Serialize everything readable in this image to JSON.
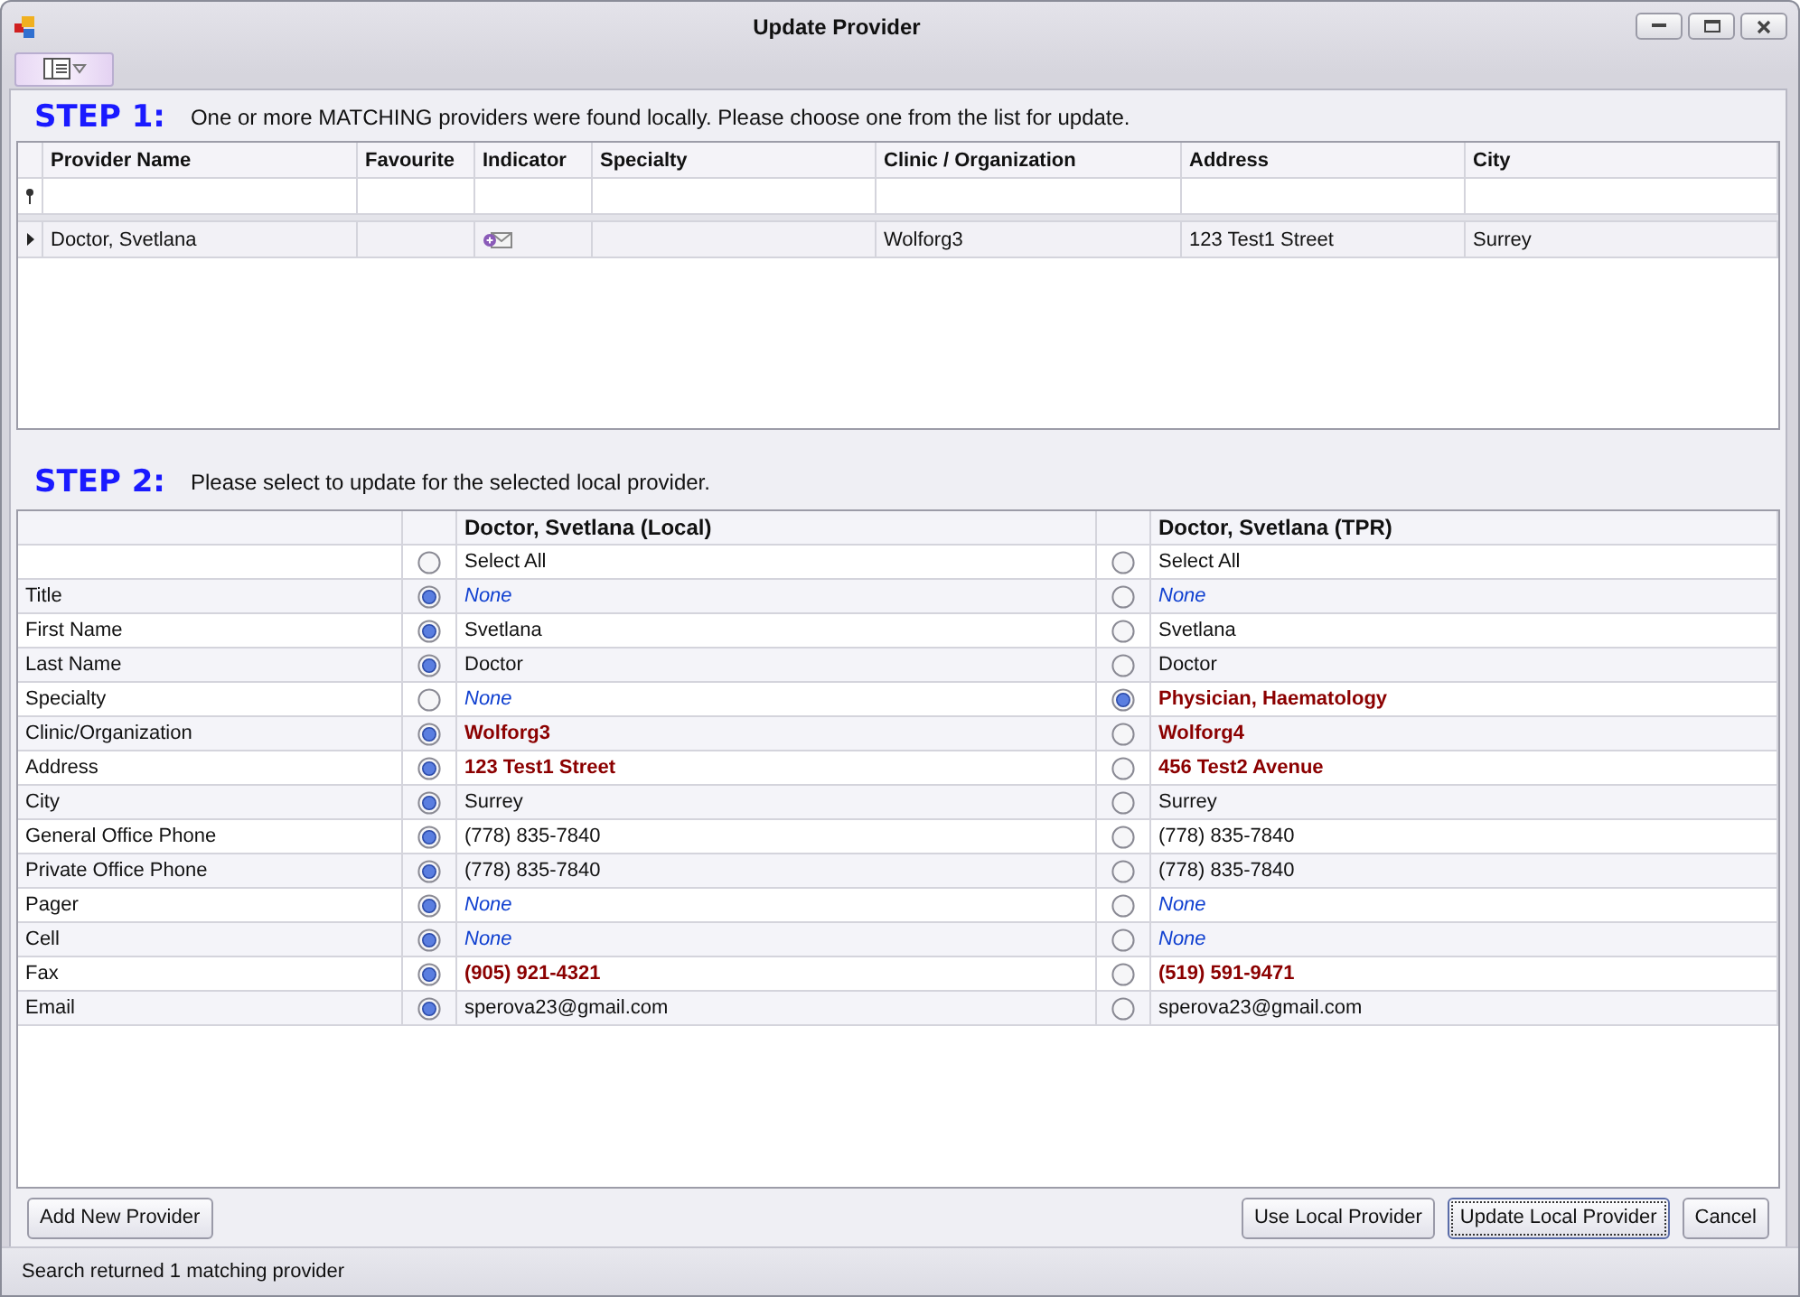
{
  "window": {
    "title": "Update Provider"
  },
  "step1": {
    "label": "STEP 1:",
    "instruction": "One or more MATCHING providers were found locally.  Please choose one from the list for update."
  },
  "providers_table": {
    "columns": [
      "Provider Name",
      "Favourite",
      "Indicator",
      "Specialty",
      "Clinic / Organization",
      "Address",
      "City"
    ],
    "rows": [
      {
        "selected": true,
        "provider_name": "Doctor, Svetlana",
        "indicator_shown": true,
        "clinic_organization": "Wolforg3",
        "address": "123  Test1 Street",
        "city": "Surrey"
      }
    ]
  },
  "step2": {
    "label": "STEP 2:",
    "instruction": "Please select to update for the selected local provider."
  },
  "compare": {
    "sources": [
      {
        "name": "Doctor, Svetlana (Local)",
        "select_all": "Select All",
        "select_all_selected": false
      },
      {
        "name": "Doctor, Svetlana (TPR)",
        "select_all": "Select All",
        "select_all_selected": false
      }
    ],
    "fields": [
      {
        "label": "Title",
        "values": [
          {
            "text": "None",
            "kind": "none",
            "selected": true
          },
          {
            "text": "None",
            "kind": "none",
            "selected": false
          }
        ]
      },
      {
        "label": "First Name",
        "values": [
          {
            "text": "Svetlana",
            "kind": "plain",
            "selected": true
          },
          {
            "text": "Svetlana",
            "kind": "plain",
            "selected": false
          }
        ]
      },
      {
        "label": "Last Name",
        "values": [
          {
            "text": "Doctor",
            "kind": "plain",
            "selected": true
          },
          {
            "text": "Doctor",
            "kind": "plain",
            "selected": false
          }
        ]
      },
      {
        "label": "Specialty",
        "values": [
          {
            "text": "None",
            "kind": "none",
            "selected": false
          },
          {
            "text": "Physician, Haematology",
            "kind": "diff",
            "selected": true
          }
        ]
      },
      {
        "label": "Clinic/Organization",
        "values": [
          {
            "text": "Wolforg3",
            "kind": "diff",
            "selected": true
          },
          {
            "text": "Wolforg4",
            "kind": "diff",
            "selected": false
          }
        ]
      },
      {
        "label": "Address",
        "values": [
          {
            "text": "123  Test1 Street",
            "kind": "diff",
            "selected": true
          },
          {
            "text": "456  Test2 Avenue",
            "kind": "diff",
            "selected": false
          }
        ]
      },
      {
        "label": "City",
        "values": [
          {
            "text": "Surrey",
            "kind": "plain",
            "selected": true
          },
          {
            "text": "Surrey",
            "kind": "plain",
            "selected": false
          }
        ]
      },
      {
        "label": "General Office Phone",
        "values": [
          {
            "text": "(778) 835-7840",
            "kind": "plain",
            "selected": true
          },
          {
            "text": "(778) 835-7840",
            "kind": "plain",
            "selected": false
          }
        ]
      },
      {
        "label": "Private Office Phone",
        "values": [
          {
            "text": "(778) 835-7840",
            "kind": "plain",
            "selected": true
          },
          {
            "text": "(778) 835-7840",
            "kind": "plain",
            "selected": false
          }
        ]
      },
      {
        "label": "Pager",
        "values": [
          {
            "text": "None",
            "kind": "none",
            "selected": true
          },
          {
            "text": "None",
            "kind": "none",
            "selected": false
          }
        ]
      },
      {
        "label": "Cell",
        "values": [
          {
            "text": "None",
            "kind": "none",
            "selected": true
          },
          {
            "text": "None",
            "kind": "none",
            "selected": false
          }
        ]
      },
      {
        "label": "Fax",
        "values": [
          {
            "text": "(905) 921-4321",
            "kind": "diff",
            "selected": true
          },
          {
            "text": "(519) 591-9471",
            "kind": "diff",
            "selected": false
          }
        ]
      },
      {
        "label": "Email",
        "values": [
          {
            "text": "sperova23@gmail.com",
            "kind": "plain",
            "selected": true
          },
          {
            "text": "sperova23@gmail.com",
            "kind": "plain",
            "selected": false
          }
        ]
      }
    ]
  },
  "left_buttons": [
    {
      "label": "Add New Provider",
      "focused": false
    }
  ],
  "right_buttons": [
    {
      "label": "Use Local Provider",
      "focused": false
    },
    {
      "label": "Update Local Provider",
      "focused": true
    },
    {
      "label": "Cancel",
      "focused": false
    }
  ],
  "status_bar": {
    "text": "Search returned 1 matching provider"
  }
}
